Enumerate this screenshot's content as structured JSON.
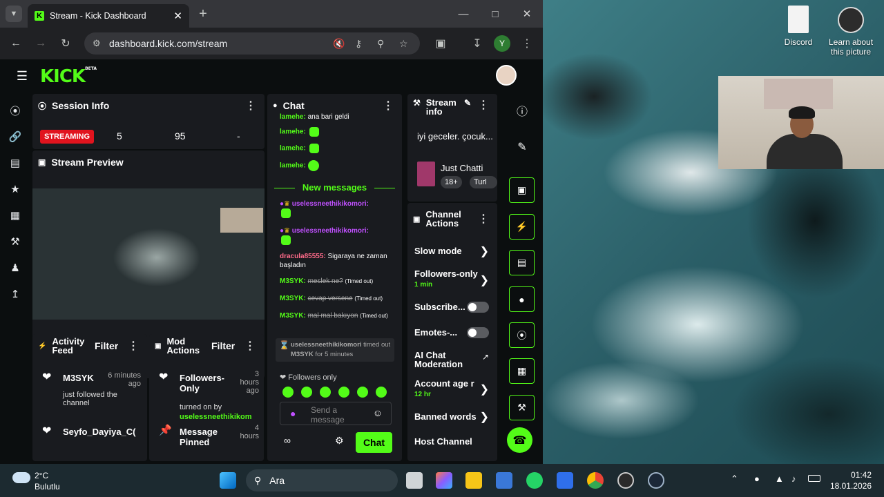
{
  "browser": {
    "tab_title": "Stream - Kick Dashboard",
    "url": "dashboard.kick.com/stream",
    "profile_initial": "Y"
  },
  "desktop": {
    "discord_label": "Discord",
    "learn_label": "Learn about this picture"
  },
  "kick": {
    "logo": "KICK",
    "logo_beta": "BETA"
  },
  "session": {
    "title": "Session Info",
    "status": "STREAMING",
    "stat1": "5",
    "stat2": "95",
    "stat3": "-"
  },
  "preview": {
    "title": "Stream Preview"
  },
  "activity": {
    "title": "Activity Feed",
    "filter": "Filter",
    "items": [
      {
        "user": "M3SYK",
        "time": "6 minutes ago",
        "desc": "just followed the channel"
      },
      {
        "user": "Seyfo_Dayiya_C(",
        "time": "",
        "desc": ""
      }
    ]
  },
  "mod": {
    "title": "Mod Actions",
    "filter": "Filter",
    "items": [
      {
        "title": "Followers-Only",
        "time": "3 hours ago",
        "desc": "turned on by",
        "user": "uselessneethikikom"
      },
      {
        "title": "Message Pinned",
        "time": "4 hours"
      }
    ]
  },
  "chat": {
    "title": "Chat",
    "top_user": "lamehe:",
    "top_text": "ana bari geldi",
    "user": "lamehe:",
    "new_messages": "New messages",
    "m1_user": "uselessneethikikomori:",
    "m2_user": "uselessneethikikomori:",
    "m3_user": "dracula85555:",
    "m3_text": "Sigaraya ne zaman başladın",
    "m4_user": "M3SYK:",
    "m4_text": "meslek ne?",
    "m4_tag": "(Timed out)",
    "m5_user": "M3SYK:",
    "m5_text": "cevap versene",
    "m5_tag": "(Timed out)",
    "m6_user": "M3SYK:",
    "m6_text": "mal mal bakıyon",
    "m6_tag": "(Timed out)",
    "sys_user": "uselessneethikikomori",
    "sys_text": "timed out",
    "sys_target": "M3SYK",
    "sys_tail": "for 5 minutes",
    "followers_only": "Followers only",
    "placeholder": "Send a message",
    "send": "Chat"
  },
  "streaminfo": {
    "title": "Stream info",
    "text": "iyi geceler. çocuk...",
    "category": "Just Chatti",
    "tag1": "18+",
    "tag2": "Turl"
  },
  "actions": {
    "title": "Channel Actions",
    "slow": "Slow mode",
    "followers": "Followers-only",
    "followers_sub": "1 min",
    "subscriber": "Subscribe...",
    "emotes": "Emotes-...",
    "ai": "AI Chat Moderation",
    "account": "Account age r",
    "account_sub": "12 hr",
    "banned": "Banned words",
    "host": "Host Channel"
  },
  "taskbar": {
    "temp": "2°C",
    "weather": "Bulutlu",
    "search": "Ara",
    "time": "01:42",
    "date": "18.01.2026"
  }
}
